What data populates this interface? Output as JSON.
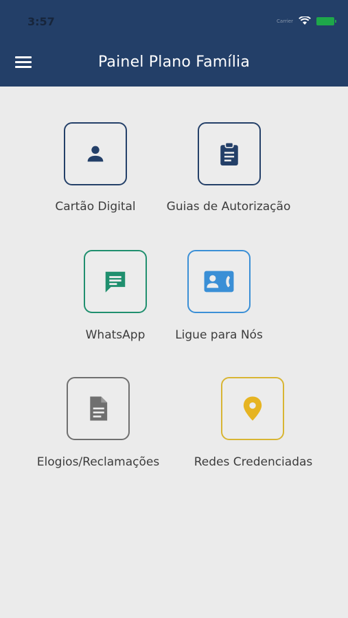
{
  "status_bar": {
    "time": "3:57",
    "carrier": "Carrier"
  },
  "header": {
    "title": "Painel Plano Família"
  },
  "tiles": [
    {
      "label": "Cartão Digital",
      "icon": "person-icon",
      "color": "#233f68"
    },
    {
      "label": "Guias de Autorização",
      "icon": "clipboard-icon",
      "color": "#233f68"
    },
    {
      "label": "WhatsApp",
      "icon": "chat-icon",
      "color": "#1f8f6e"
    },
    {
      "label": "Ligue para Nós",
      "icon": "contact-phone-icon",
      "color": "#3a8fd6"
    },
    {
      "label": "Elogios/Reclamações",
      "icon": "document-icon",
      "color": "#6f6f6f"
    },
    {
      "label": "Redes Credenciadas",
      "icon": "location-pin-icon",
      "color": "#d8b533"
    }
  ]
}
